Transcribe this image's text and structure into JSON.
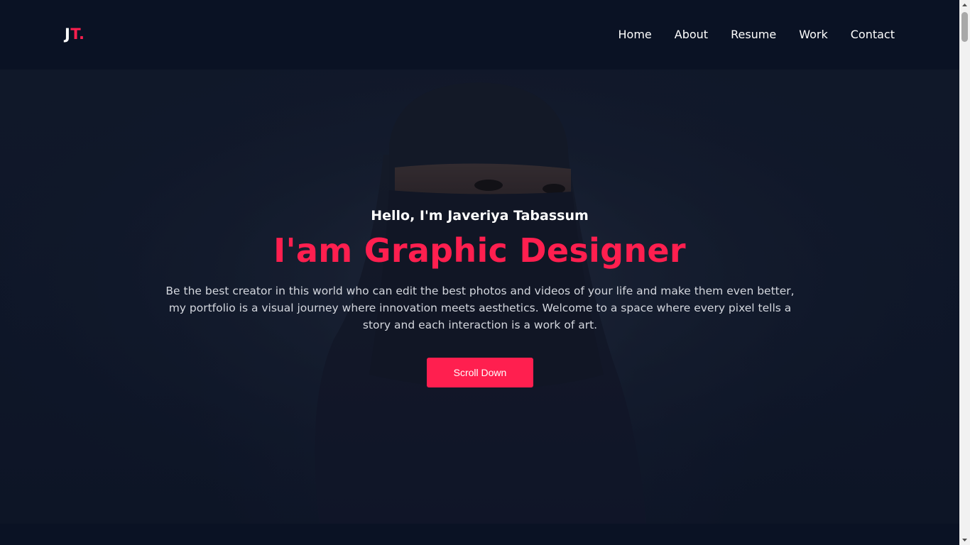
{
  "logo": {
    "main": "J",
    "accent": "T."
  },
  "nav": {
    "items": [
      {
        "label": "Home"
      },
      {
        "label": "About"
      },
      {
        "label": "Resume"
      },
      {
        "label": "Work"
      },
      {
        "label": "Contact"
      }
    ]
  },
  "hero": {
    "greeting": "Hello, I'm Javeriya Tabassum",
    "headline": "I'am Graphic Designer",
    "bio": "Be the best creator in this world who can edit the best photos and videos of your life and make them even better, my portfolio is a visual journey where innovation meets aesthetics. Welcome to a space where every pixel tells a story and each interaction is a work of art.",
    "button_label": "Scroll Down"
  },
  "colors": {
    "background": "#0a1224",
    "accent": "#ff1f4f",
    "text": "#ffffff"
  },
  "icons": {
    "scroll_up": "chevron-up-icon",
    "scroll_down": "chevron-down-icon"
  }
}
